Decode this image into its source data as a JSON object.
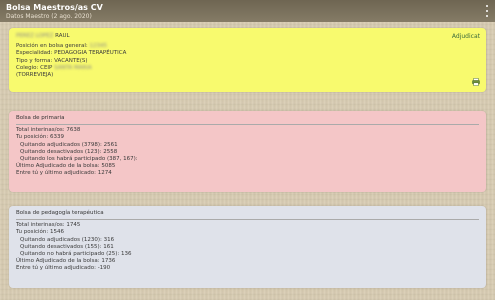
{
  "app": {
    "title": "Bolsa Maestros/as CV",
    "subtitle": "Datos Maestro (2 ago. 2020)"
  },
  "profile": {
    "name_blurred": "PEREZ LOPEZ",
    "name_visible": "RAUL",
    "edit_label": "Adjudicat",
    "lines": [
      {
        "label": "Posición en bolsa general: ",
        "value_blurred": "12345"
      },
      {
        "label": "Especialidad: PEDAGOGIA TERAPÉUTICA",
        "value_blurred": ""
      },
      {
        "label": "Tipo y forma: VACANTE(S)",
        "value_blurred": ""
      },
      {
        "label": "Colegio: CEIP ",
        "value_blurred": "SANTA MARIA"
      },
      {
        "label": "(TORREVIEJA)",
        "value_blurred": ""
      }
    ],
    "print_icon": "print-icon"
  },
  "bolsa_primaria": {
    "title": "Bolsa de primaria",
    "lines": [
      {
        "text": "Total interinas/os: 7638",
        "indent": false
      },
      {
        "text": "Tu posición: 6339",
        "indent": false
      },
      {
        "text": "Quitando adjudicados (3798): 2561",
        "indent": true
      },
      {
        "text": "Quitando desactivados (123): 2558",
        "indent": true
      },
      {
        "text": "Quitando los habrá participado (387, 167):",
        "indent": true
      },
      {
        "text": "Último Adjudicado de la bolsa: 5085",
        "indent": false
      },
      {
        "text": "Entre tú y último adjudicado: 1274",
        "indent": false
      }
    ]
  },
  "bolsa_pedagogia": {
    "title": "Bolsa de pedagogía terapéutica",
    "lines": [
      {
        "text": "Total interinas/os: 1745",
        "indent": false
      },
      {
        "text": "Tu posición: 1546",
        "indent": false
      },
      {
        "text": "Quitando adjudicados (1230): 316",
        "indent": true
      },
      {
        "text": "Quitando desactivados (155): 161",
        "indent": true
      },
      {
        "text": "Quitando no habrá participado (25): 136",
        "indent": true
      },
      {
        "text": "Último Adjudicado de la bolsa: 1736",
        "indent": false
      },
      {
        "text": "Entre tú y último adjudicado: -190",
        "indent": false
      }
    ]
  },
  "colors": {
    "appbar": "#7a705c",
    "yellow_card": "#f8fa6e",
    "pink_card": "#f4c6c7",
    "blue_card": "#dfe2ea"
  }
}
